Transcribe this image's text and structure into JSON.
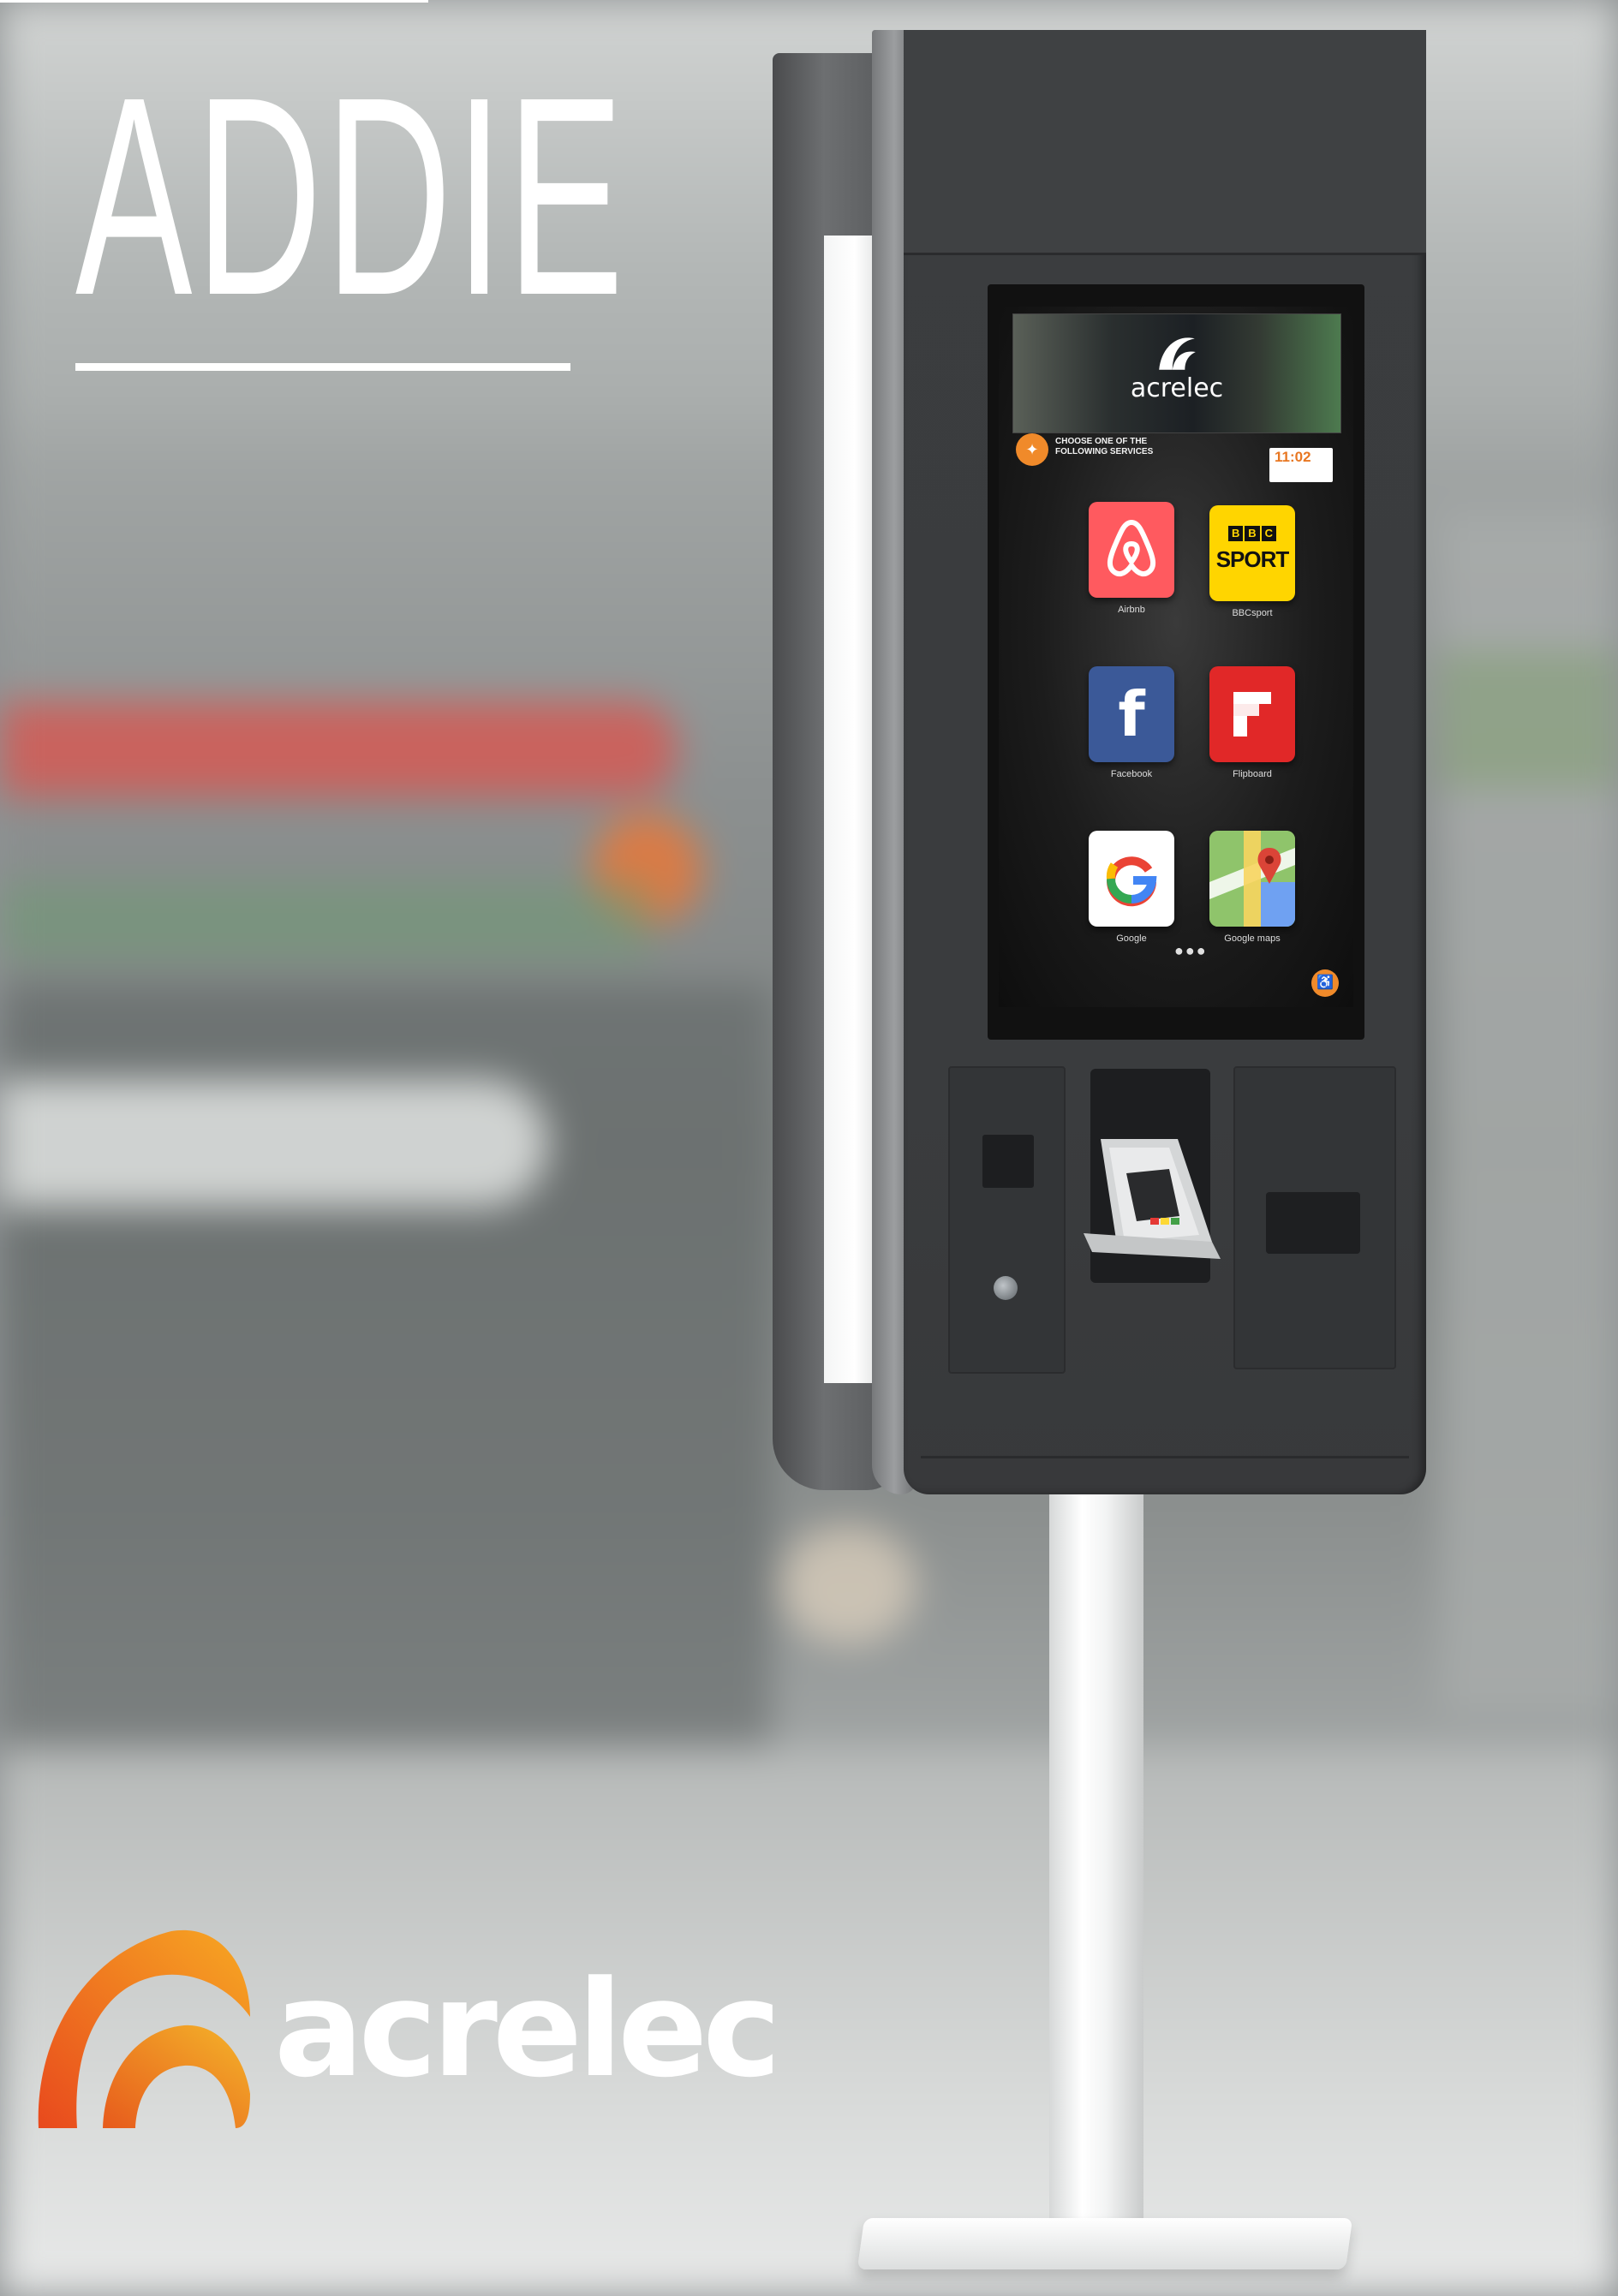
{
  "page": {
    "title": "ADDIE",
    "brand": "acrelec"
  },
  "colors": {
    "brand_orange": "#F08A2A",
    "background": "#8F9394",
    "title": "#FFFFFF",
    "kiosk_body": "#3A3C3E"
  },
  "kiosk_screen": {
    "banner_brand": "acrelec",
    "prompt": "CHOOSE ONE OF THE FOLLOWING SERVICES",
    "clock_time": "11:02",
    "apps": [
      {
        "label": "Airbnb",
        "icon": "airbnb-icon",
        "color": "#FF5A5F"
      },
      {
        "label": "BBCsport",
        "icon": "bbc-sport-icon",
        "color": "#FFD500"
      },
      {
        "label": "Facebook",
        "icon": "facebook-icon",
        "color": "#3B5998"
      },
      {
        "label": "Flipboard",
        "icon": "flipboard-icon",
        "color": "#E12828"
      },
      {
        "label": "Google",
        "icon": "google-icon",
        "color": "#FFFFFF"
      },
      {
        "label": "Google maps",
        "icon": "google-maps-icon",
        "color": "#8FC46B"
      }
    ],
    "bbc_top": "BBC",
    "bbc_bottom": "SPORT"
  }
}
